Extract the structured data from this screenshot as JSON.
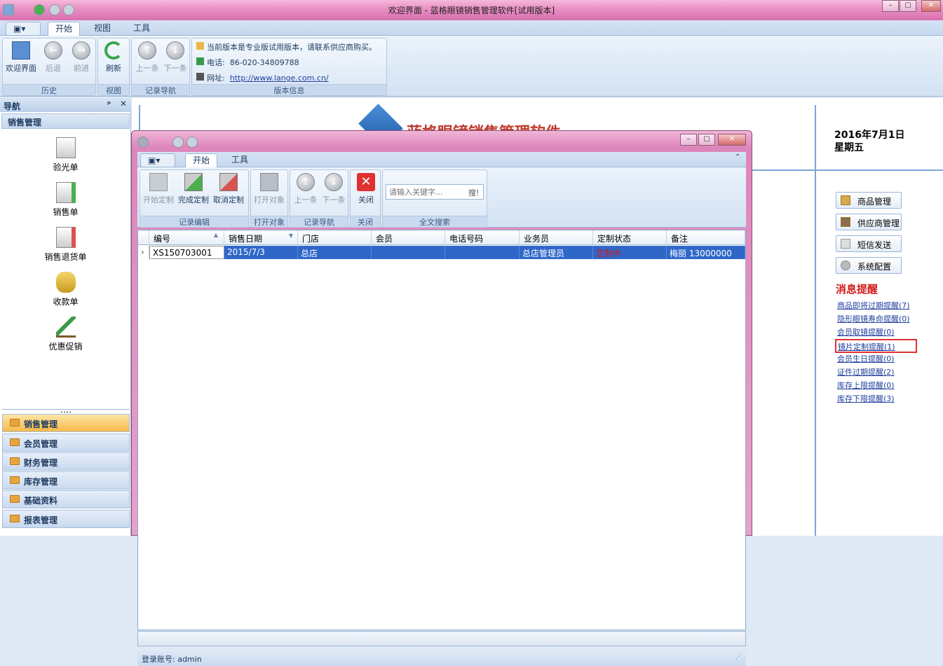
{
  "app": {
    "title": "欢迎界面 - 蓝格眼镜销售管理软件[试用版本]"
  },
  "tabs": [
    "开始",
    "视图",
    "工具"
  ],
  "ribbon": {
    "history": {
      "label": "历史",
      "buttons": [
        "欢迎界面",
        "后退",
        "前进"
      ]
    },
    "view": {
      "label": "视图",
      "buttons": [
        "刷新"
      ]
    },
    "nav": {
      "label": "记录导航",
      "buttons": [
        "上一条",
        "下一条"
      ]
    },
    "version": {
      "label": "版本信息",
      "notice": "当前版本是专业版试用版本，请联系供应商购买。",
      "phone_label": "电话:",
      "phone": "86-020-34809788",
      "url_label": "网址:",
      "url": "http://www.lange.com.cn/"
    }
  },
  "nav": {
    "header": "导航",
    "section": "销售管理",
    "items": [
      "验光单",
      "销售单",
      "销售退货单",
      "收款单",
      "优惠促销"
    ],
    "bottom": [
      "销售管理",
      "会员管理",
      "财务管理",
      "库存管理",
      "基础资料",
      "报表管理"
    ]
  },
  "main": {
    "logo_text": "蓝格眼镜销售管理软件",
    "date": "2016年7月1日",
    "weekday": "星期五"
  },
  "right": {
    "buttons": [
      "商品管理",
      "供应商管理",
      "短信发送",
      "系统配置"
    ],
    "msg_title": "消息提醒",
    "messages": [
      "商品即将过期提醒(7)",
      "隐形眼镜寿命提醒(0)",
      "会员取镜提醒(0)",
      "镜片定制提醒(1)",
      "会员生日提醒(0)",
      "证件过期提醒(2)",
      "库存上限提醒(0)",
      "库存下限提醒(3)"
    ]
  },
  "dialog": {
    "tabs": [
      "开始",
      "工具"
    ],
    "groups": {
      "record_edit": "记录编辑",
      "open_obj": "打开对象",
      "rec_nav": "记录导航",
      "close": "关闭",
      "search": "全文搜索"
    },
    "buttons": {
      "start": "开始定制",
      "finish": "完成定制",
      "cancel": "取消定制",
      "open": "打开对象",
      "prev": "上一条",
      "next": "下一条",
      "close": "关闭"
    },
    "search": {
      "placeholder": "请输入关键字...",
      "btn": "搜!"
    },
    "columns": [
      "编号",
      "销售日期",
      "门店",
      "会员",
      "电话号码",
      "业务员",
      "定制状态",
      "备注"
    ],
    "row": [
      "XS150703001",
      "2015/7/3",
      "总店",
      "",
      "",
      "总店管理员",
      "定制中",
      "梅丽 13000000"
    ],
    "status": "登录账号: admin"
  }
}
